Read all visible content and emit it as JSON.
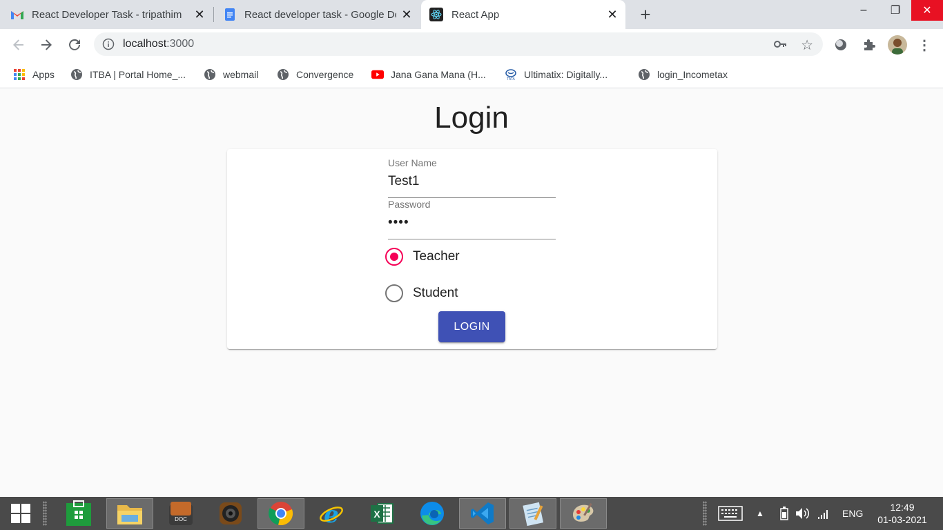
{
  "browser": {
    "tabs": [
      {
        "title": "React Developer Task - tripathim",
        "favicon": "gmail-icon"
      },
      {
        "title": "React developer task - Google Do",
        "favicon": "google-docs-icon"
      },
      {
        "title": "React App",
        "favicon": "react-icon",
        "active": true
      }
    ],
    "new_tab_label": "+",
    "window_controls": {
      "minimize": "–",
      "restore": "❐",
      "close": "✕"
    },
    "url_host": "localhost",
    "url_port": ":3000",
    "bookmarks": [
      {
        "label": "Apps",
        "icon": "apps-grid-icon"
      },
      {
        "label": "ITBA | Portal Home_...",
        "icon": "globe-icon"
      },
      {
        "label": "webmail",
        "icon": "globe-icon"
      },
      {
        "label": "Convergence",
        "icon": "globe-icon"
      },
      {
        "label": "Jana Gana Mana (H...",
        "icon": "youtube-icon"
      },
      {
        "label": "Ultimatix: Digitally...",
        "icon": "tata-icon"
      },
      {
        "label": "login_Incometax",
        "icon": "globe-icon"
      }
    ]
  },
  "login": {
    "title": "Login",
    "username_label": "User Name",
    "username_value": "Test1",
    "password_label": "Password",
    "password_value": "••••",
    "roles": [
      {
        "label": "Teacher",
        "selected": true
      },
      {
        "label": "Student",
        "selected": false
      }
    ],
    "submit_label": "LOGIN"
  },
  "colors": {
    "primary": "#3f51b5",
    "radio_selected": "#f50057",
    "taskbar": "#4a4a4a"
  },
  "taskbar": {
    "apps": [
      "windows-store-icon",
      "file-explorer-icon",
      "doc-viewer-icon",
      "speaker-app-icon",
      "chrome-icon",
      "internet-explorer-icon",
      "excel-icon",
      "edge-icon",
      "vscode-icon",
      "notepad-icon",
      "paint-icon"
    ],
    "language": "ENG",
    "time": "12:49",
    "date": "01-03-2021"
  }
}
